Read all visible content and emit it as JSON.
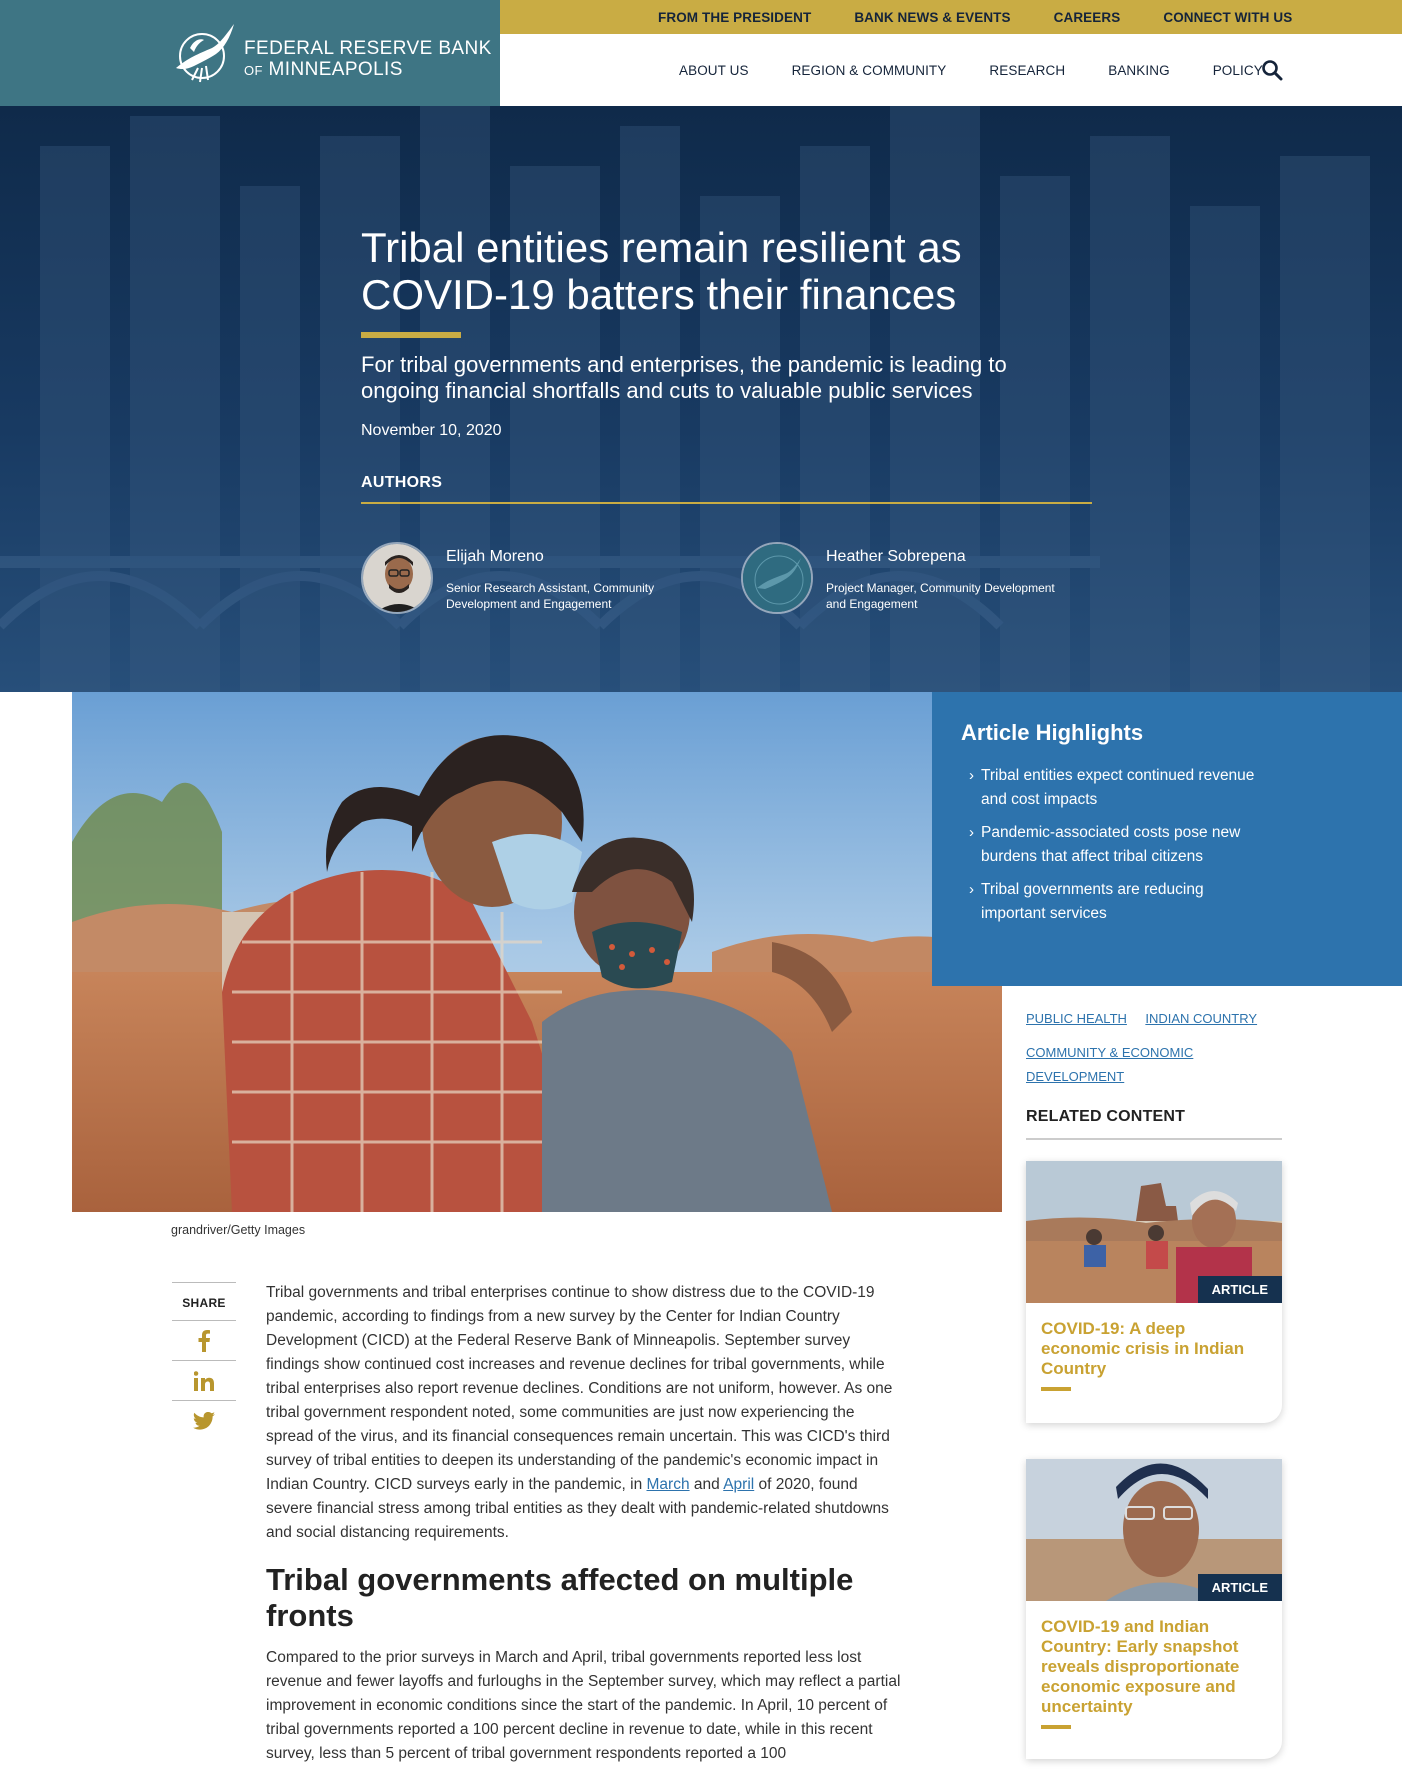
{
  "utility_nav": {
    "items": [
      "FROM THE PRESIDENT",
      "BANK NEWS & EVENTS",
      "CAREERS",
      "CONNECT WITH US"
    ]
  },
  "logo": {
    "line1": "FEDERAL RESERVE BANK",
    "line2_prefix": "OF",
    "line2_main": "MINNEAPOLIS"
  },
  "main_nav": {
    "items": [
      "ABOUT US",
      "REGION & COMMUNITY",
      "RESEARCH",
      "BANKING",
      "POLICY"
    ],
    "search_icon": "search-icon"
  },
  "hero": {
    "title": "Tribal entities remain resilient as COVID-19 batters their finances",
    "subtitle": "For tribal governments and enterprises, the pandemic is leading to ongoing financial shortfalls and cuts to valuable public services",
    "date": "November 10, 2020",
    "authors_heading": "AUTHORS",
    "authors": [
      {
        "name": "Elijah Moreno",
        "role": "Senior Research Assistant, Community Development and Engagement"
      },
      {
        "name": "Heather Sobrepena",
        "role": "Project Manager, Community Development and Engagement"
      }
    ]
  },
  "photo_caption": "grandriver/Getty Images",
  "highlights": {
    "heading": "Article Highlights",
    "items": [
      "Tribal entities expect continued revenue and cost impacts",
      "Pandemic-associated costs pose new burdens that affect tribal citizens",
      "Tribal governments are reducing important services"
    ]
  },
  "tags": [
    "PUBLIC HEALTH",
    "INDIAN COUNTRY",
    "COMMUNITY & ECONOMIC DEVELOPMENT"
  ],
  "related": {
    "heading": "RELATED CONTENT",
    "cards": [
      {
        "badge": "ARTICLE",
        "title": "COVID-19: A deep economic crisis in Indian Country"
      },
      {
        "badge": "ARTICLE",
        "title": "COVID-19 and Indian Country: Early snapshot reveals disproportionate economic exposure and uncertainty"
      }
    ]
  },
  "share": {
    "label": "SHARE",
    "icons": [
      "facebook-icon",
      "linkedin-icon",
      "twitter-icon"
    ]
  },
  "body": {
    "paragraph1_before": "Tribal governments and tribal enterprises continue to show distress due to the COVID-19 pandemic, according to findings from a new survey by the Center for Indian Country Development (CICD) at the Federal Reserve Bank of Minneapolis. September survey findings show continued cost increases and revenue declines for tribal governments, while tribal enterprises also report revenue declines. Conditions are not uniform, however. As one tribal government respondent noted, some communities are just now experiencing the spread of the virus, and its financial consequences remain uncertain. This was CICD's third survey of tribal entities to deepen its understanding of the pandemic's economic impact in Indian Country. CICD surveys early in the pandemic, in",
    "link_march": "March",
    "and_word": "and",
    "link_april": "April",
    "paragraph1_after": "of 2020, found severe financial stress among tribal entities as they dealt with pandemic-related shutdowns and social distancing requirements.",
    "section_heading": "Tribal governments affected on multiple fronts",
    "paragraph2": "Compared to the prior surveys in March and April, tribal governments reported less lost revenue and fewer layoffs and furloughs in the September survey, which may reflect a partial improvement in economic conditions since the start of the pandemic. In April, 10 percent of tribal governments reported a 100 percent decline in revenue to date, while in this recent survey, less than 5 percent of tribal government respondents reported a 100"
  },
  "colors": {
    "gold": "#c9ac44",
    "teal": "#3e7584",
    "navy": "#15243a",
    "highlight_blue": "#2d73ad"
  }
}
